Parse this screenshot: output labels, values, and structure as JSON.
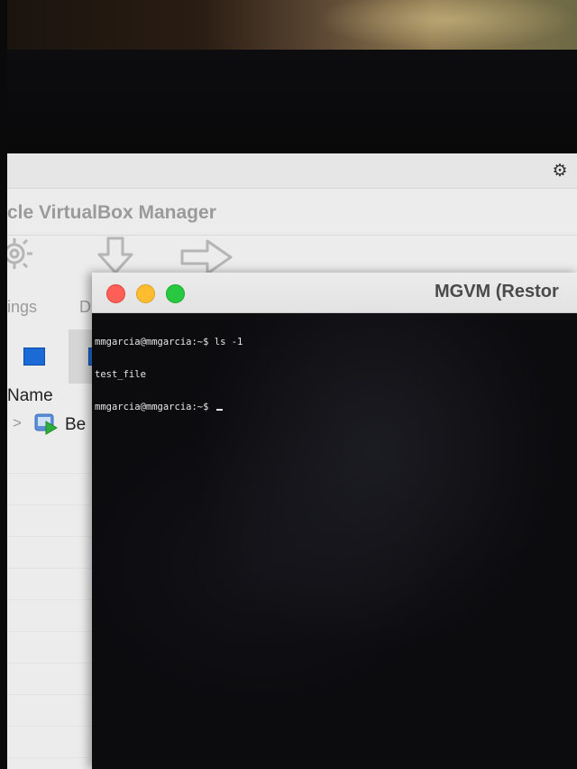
{
  "vbox_manager": {
    "title": "cle VirtualBox Manager",
    "toolbar": {
      "settings_label": "ings",
      "discard_label": "D"
    },
    "list": {
      "column_name": "Name",
      "vm_row_label": "Be"
    }
  },
  "vm_window": {
    "title": "MGVM (Restor",
    "terminal_lines": [
      "mmgarcia@mmgarcia:~$ ls -1",
      "test_file",
      "mmgarcia@mmgarcia:~$ "
    ]
  },
  "colors": {
    "traffic_close": "#ff5f57",
    "traffic_minimize": "#febc2e",
    "traffic_zoom": "#28c840",
    "selection_blue": "#1b6ad6"
  }
}
